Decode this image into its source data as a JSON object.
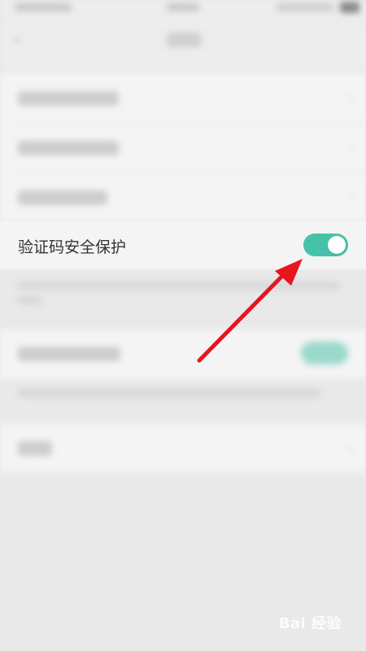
{
  "setting": {
    "label": "验证码安全保护",
    "toggle_on": true,
    "accent_color": "#45c3aa"
  },
  "annotation": {
    "arrow_color": "#e8141e"
  },
  "watermark": {
    "text": "Bai 经验"
  }
}
